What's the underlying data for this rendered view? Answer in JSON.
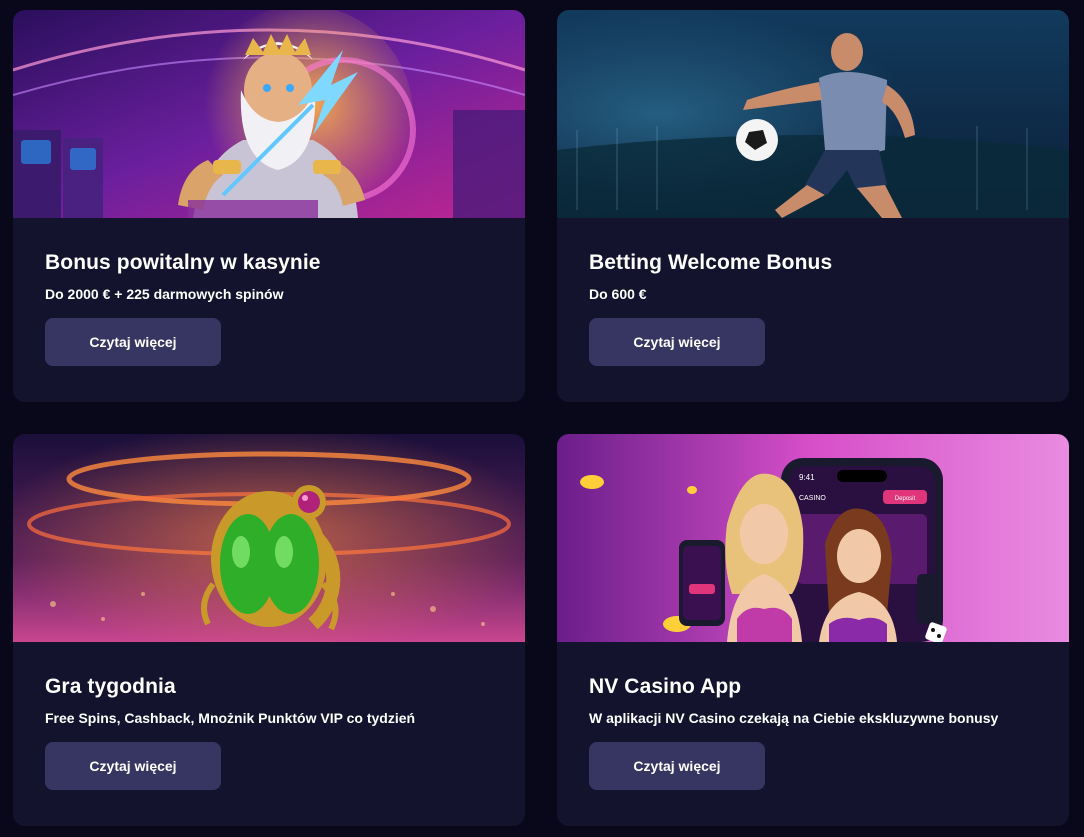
{
  "promotions": [
    {
      "title": "Bonus powitalny w kasynie",
      "subtitle": "Do 2000 € + 225 darmowych spinów",
      "button_label": "Czytaj więcej"
    },
    {
      "title": "Betting Welcome Bonus",
      "subtitle": "Do 600 €",
      "button_label": "Czytaj więcej"
    },
    {
      "title": "Gra tygodnia",
      "subtitle": "Free Spins, Cashback, Mnożnik Punktów VIP co tydzień",
      "button_label": "Czytaj więcej"
    },
    {
      "title": "NV Casino App",
      "subtitle": "W aplikacji NV Casino czekają na Ciebie ekskluzywne bonusy",
      "button_label": "Czytaj więcej"
    }
  ],
  "banner_art": {
    "phone_time": "9:41",
    "phone_brand": "CASINO",
    "phone_deposit": "Deposit"
  },
  "colors": {
    "page_background": "#08081a",
    "card_background": "#13132e",
    "button_background": "#373561",
    "text": "#ffffff"
  }
}
